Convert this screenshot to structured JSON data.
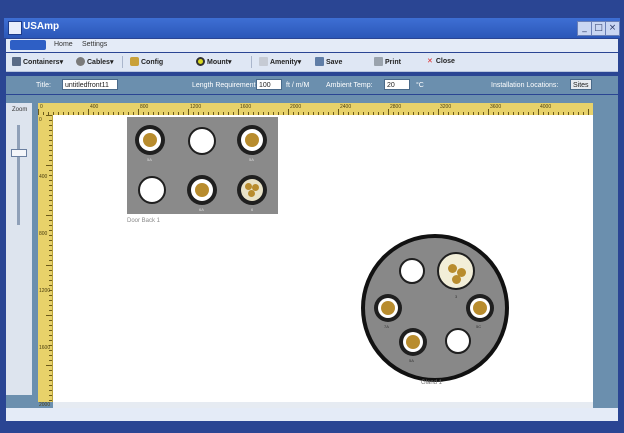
{
  "window": {
    "title": "USAmp",
    "minimize": "_",
    "maximize": "□",
    "close": "×"
  },
  "menu": {
    "file_label": "",
    "items": [
      "Home",
      "Settings"
    ]
  },
  "toolbar": {
    "containers": "Containers",
    "cables": "Cables",
    "config": "Config",
    "mount": "Mount",
    "amenity": "Amenity",
    "save": "Save",
    "print": "Print",
    "close": "Close"
  },
  "properties": {
    "title_label": "Title:",
    "title_value": "untitledfront11",
    "length_label": "Length Requirement:",
    "length_value": "100",
    "length_unit": "ft / m/M",
    "ambient_label": "Ambient Temp:",
    "ambient_value": "20",
    "ambient_unit": "°C",
    "install_label": "Installation Locations:",
    "install_value": "Sites"
  },
  "zoom": {
    "label": "Zoom"
  },
  "ruler": {
    "top_numbers": [
      "0",
      "400",
      "800",
      "1200",
      "1600",
      "2000",
      "2400",
      "2800",
      "3200",
      "3600",
      "4000"
    ],
    "left_numbers": [
      "0",
      "400",
      "800",
      "1200",
      "1600",
      "2000"
    ]
  },
  "canvas": {
    "panel_a_label": "Door Back 1",
    "plate_label": "Gland 1",
    "panel_a_sublabels": [
      "5A",
      "5A",
      "6A",
      "6A",
      "6"
    ],
    "plate_sublabels": [
      "3",
      "7A",
      "5A",
      "5C"
    ]
  },
  "colors": {
    "accent": "#2e5fc5",
    "connector_core": "#b88c2e",
    "panel": "#8a8a8a",
    "ruler": "#e8d26a"
  }
}
